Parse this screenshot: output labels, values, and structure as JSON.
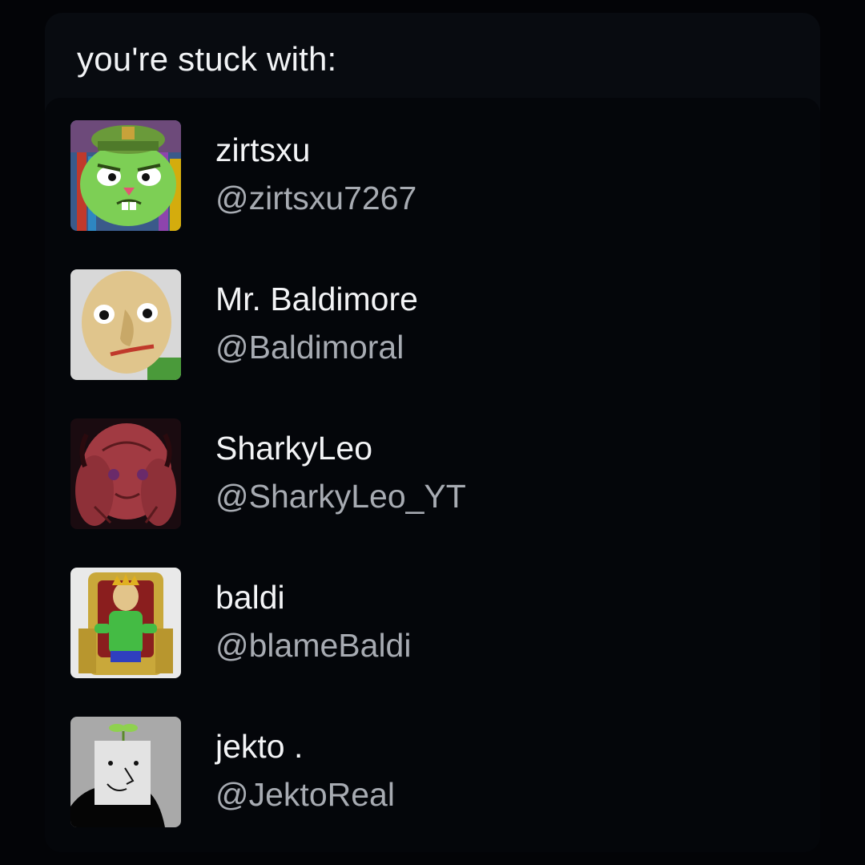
{
  "header": {
    "title": "you're stuck with:"
  },
  "users": [
    {
      "name": "zirtsxu",
      "handle": "@zirtsxu7267",
      "avatar_icon": "green-bear-soldier-avatar"
    },
    {
      "name": "Mr. Baldimore",
      "handle": "@Baldimoral",
      "avatar_icon": "bald-teacher-avatar"
    },
    {
      "name": "SharkyLeo",
      "handle": "@SharkyLeo_YT",
      "avatar_icon": "red-sketch-avatar"
    },
    {
      "name": "baldi",
      "handle": "@blameBaldi",
      "avatar_icon": "king-on-throne-avatar"
    },
    {
      "name": "jekto .",
      "handle": "@JektoReal",
      "avatar_icon": "sprout-square-head-avatar"
    }
  ],
  "colors": {
    "background": "#030407",
    "card": "#080b10",
    "list": "#04060a",
    "name_text": "#f3f4f6",
    "handle_text": "#a7abb2"
  }
}
